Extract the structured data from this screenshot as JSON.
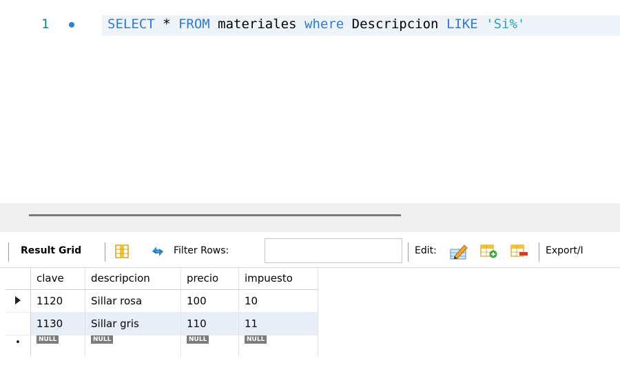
{
  "editor": {
    "line_number": "1",
    "tokens": [
      {
        "t": "SELECT",
        "c": "kw"
      },
      {
        "t": " * ",
        "c": "plain"
      },
      {
        "t": "FROM",
        "c": "kw"
      },
      {
        "t": " materiales ",
        "c": "plain"
      },
      {
        "t": "where",
        "c": "kw"
      },
      {
        "t": " Descripcion ",
        "c": "plain"
      },
      {
        "t": "LIKE",
        "c": "kw"
      },
      {
        "t": " ",
        "c": "plain"
      },
      {
        "t": "'Si%'",
        "c": "str"
      }
    ]
  },
  "toolbar": {
    "result_grid_label": "Result Grid",
    "filter_label": "Filter Rows:",
    "filter_value": "",
    "edit_label": "Edit:",
    "export_label": "Export/I"
  },
  "grid": {
    "columns": [
      "clave",
      "descripcion",
      "precio",
      "impuesto"
    ],
    "rows": [
      [
        "1120",
        "Sillar rosa",
        "100",
        "10"
      ],
      [
        "1130",
        "Sillar gris",
        "110",
        "11"
      ]
    ],
    "null_label": "NULL"
  },
  "icons": {
    "row_pointer": "triangle-right-icon",
    "new_row": "asterisk-icon",
    "form_toggle": "column-grid-icon",
    "refresh": "refresh-arrows-icon",
    "edit": "pencil-edit-icon",
    "add_row": "add-row-icon",
    "delete_row": "delete-row-icon"
  },
  "colors": {
    "keyword": "#2f7ad4",
    "string": "#2aa3b5",
    "line_number": "#1c7f80",
    "selected_row_bg": "#e8eef8"
  }
}
